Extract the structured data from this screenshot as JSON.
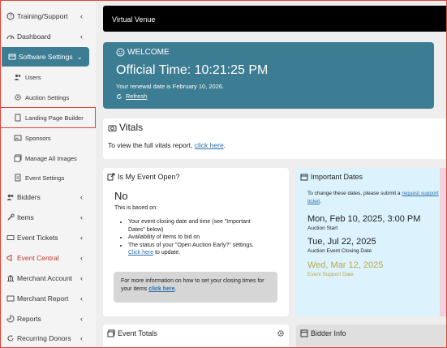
{
  "sidebar": {
    "items": [
      {
        "label": "Training/Support",
        "icon": "question-circle-icon"
      },
      {
        "label": "Dashboard",
        "icon": "dashboard-icon"
      },
      {
        "label": "Software Settings",
        "icon": "settings-icon"
      },
      {
        "label": "Bidders",
        "icon": "people-icon"
      },
      {
        "label": "Items",
        "icon": "wrench-icon"
      },
      {
        "label": "Event Tickets",
        "icon": "ticket-icon"
      },
      {
        "label": "Event Central",
        "icon": "megaphone-icon"
      },
      {
        "label": "Merchant Account",
        "icon": "bank-icon"
      },
      {
        "label": "Merchant Report",
        "icon": "report-icon"
      },
      {
        "label": "Reports",
        "icon": "chart-icon"
      },
      {
        "label": "Recurring Donors",
        "icon": "refresh-icon"
      }
    ],
    "sub_items": [
      {
        "label": "Users",
        "icon": "users-icon"
      },
      {
        "label": "Auction Settings",
        "icon": "gear-icon"
      },
      {
        "label": "Landing Page Builder",
        "icon": "page-icon"
      },
      {
        "label": "Sponsors",
        "icon": "image-icon"
      },
      {
        "label": "Manage All Images",
        "icon": "images-icon"
      },
      {
        "label": "Event Settings",
        "icon": "event-settings-icon"
      }
    ],
    "active_color": "#3c7d93"
  },
  "topbar": {
    "title": "Virtual Venue"
  },
  "welcome": {
    "title": "WELCOME",
    "time": "Official Time: 10:21:25 PM",
    "renewal": "Your renewal date is February 10, 2026.",
    "refresh": "Refresh"
  },
  "vitals": {
    "title": "Vitals",
    "text": "To view the full vitals report,",
    "link": "click here",
    "after": "."
  },
  "open": {
    "title": "Is My Event Open?",
    "answer": "No",
    "based": "This is based on:",
    "bullets": [
      "Your event closing date and time (see \"Important Dates\" below)",
      "Availability of items to bid on",
      "The status of your \"Open Auction Early?\" settings."
    ],
    "bullet_link": "Click here",
    "bullet_link_after": "to update.",
    "info_text": "For more information on how to set your closing times for your items",
    "info_link": "click here",
    "info_after": "."
  },
  "dates": {
    "title": "Important Dates",
    "desc": "To change these dates, please submit a",
    "desc_link": "request support ticket",
    "desc_after": ".",
    "entries": [
      {
        "date": "Mon, Feb 10, 2025, 3:00 PM",
        "label": "Auction Start"
      },
      {
        "date": "Tue, Jul 22, 2025",
        "label": "Auction Event Closing Date"
      },
      {
        "date": "Wed, Mar 12, 2025",
        "label": "Event Support Date"
      }
    ]
  },
  "totals": {
    "title": "Event Totals"
  },
  "bidder": {
    "title": "Bidder Info"
  }
}
